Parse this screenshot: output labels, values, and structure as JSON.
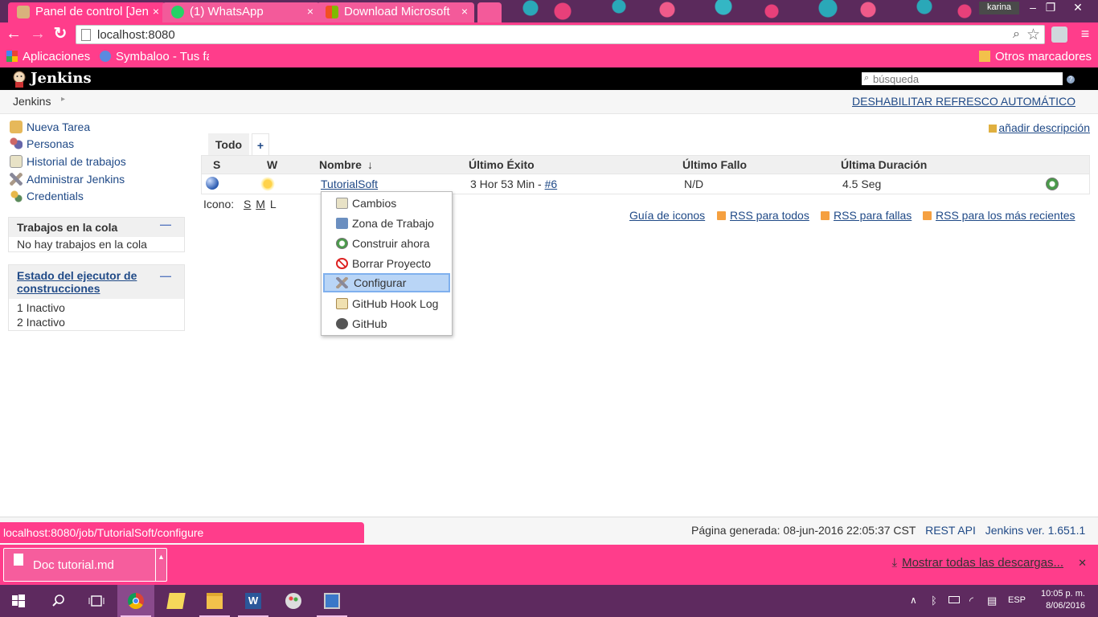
{
  "browser": {
    "tabs": [
      {
        "label": "Panel de control [Jen",
        "icon": "jenkins-favicon-icon",
        "active": true
      },
      {
        "label": "(1) WhatsApp",
        "icon": "whatsapp-icon",
        "active": false
      },
      {
        "label": "Download Microsoft",
        "icon": "microsoft-icon",
        "active": false
      }
    ],
    "tab_close": "×",
    "user": "karina",
    "window_controls": {
      "minimize": "–",
      "restore": "❐",
      "close": "✕"
    },
    "url": "localhost:8080",
    "bookmarks": {
      "apps": "Aplicaciones",
      "symbaloo": "Symbaloo - Tus fa",
      "other": "Otros marcadores"
    }
  },
  "jenkins": {
    "title": "Jenkins",
    "search_placeholder": "búsqueda",
    "help": "?",
    "breadcrumb": {
      "root": "Jenkins",
      "arrow": "▸"
    },
    "auto_refresh": "DESHABILITAR REFRESCO AUTOMÁTICO",
    "tasks": [
      "Nueva Tarea",
      "Personas",
      "Historial de trabajos",
      "Administrar Jenkins",
      "Credentials"
    ],
    "queue": {
      "title": "Trabajos en la cola",
      "collapse": "—",
      "empty": "No hay trabajos en la cola"
    },
    "executors": {
      "title": "Estado del ejecutor de construcciones",
      "collapse": "—",
      "rows": [
        "1 Inactivo",
        "2 Inactivo"
      ]
    },
    "add_description": "añadir descripción",
    "view_tabs": {
      "all": "Todo",
      "add": "+"
    },
    "table": {
      "headers": {
        "s": "S",
        "w": "W",
        "name": "Nombre",
        "sort": "↓",
        "last_success": "Último Éxito",
        "last_failure": "Último Fallo",
        "last_duration": "Última Duración"
      },
      "row": {
        "name": "TutorialSoft",
        "last_success": "3 Hor 53 Min - ",
        "build": "#6",
        "last_failure": "N/D",
        "last_duration": "4.5 Seg",
        "status": "blue",
        "weather": "sunny"
      }
    },
    "icon_legend": {
      "label": "Icono:",
      "s": "S",
      "m": "M",
      "l": "L"
    },
    "rss": {
      "legend": "Guía de iconos",
      "all": "RSS para todos",
      "failures": "RSS para fallas",
      "latest": "RSS para los más recientes"
    },
    "context_menu": [
      {
        "label": "Cambios",
        "icon": "notepad-icon"
      },
      {
        "label": "Zona de Trabajo",
        "icon": "folder-icon"
      },
      {
        "label": "Construir ahora",
        "icon": "build-clock-icon"
      },
      {
        "label": "Borrar Proyecto",
        "icon": "no-entry-icon"
      },
      {
        "label": "Configurar",
        "icon": "wrench-screwdriver-icon",
        "highlighted": true
      },
      {
        "label": "GitHub Hook Log",
        "icon": "clipboard-icon"
      },
      {
        "label": "GitHub",
        "icon": "github-icon"
      }
    ],
    "footer": {
      "generated": "Página generada: 08-jun-2016 22:05:37 CST",
      "rest_api": "REST API",
      "version": "Jenkins ver. 1.651.1"
    }
  },
  "status_url": "localhost:8080/job/TutorialSoft/configure",
  "downloads": {
    "file": "Doc tutorial.md",
    "caret": "▲",
    "show_all": "Mostrar todas las descargas...",
    "close": "✕"
  },
  "taskbar": {
    "apps": [
      "windows-start-icon",
      "search-icon",
      "task-view-icon",
      "chrome-icon",
      "sticky-notes-icon",
      "file-explorer-icon",
      "word-icon",
      "paint-icon",
      "remote-desktop-icon"
    ],
    "lang": "ESP",
    "time": "10:05 p. m.",
    "date": "8/06/2016"
  },
  "colors": {
    "accent": "#ff3d8b",
    "taskbar": "#5e2a5f",
    "link": "#204a87",
    "jenkins_header": "#000000"
  }
}
